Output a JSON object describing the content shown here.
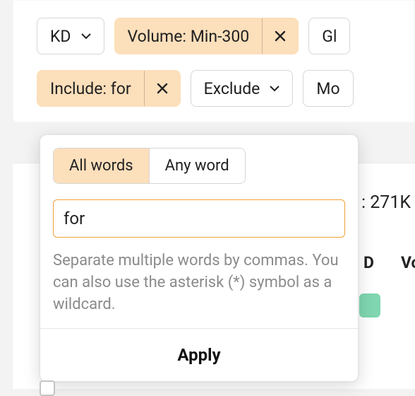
{
  "filters": {
    "kd_label": "KD",
    "volume_label": "Volume: Min-300",
    "global_label": "Gl",
    "include_label": "Include: for",
    "exclude_label": "Exclude",
    "more_label": "Mo"
  },
  "include_popover": {
    "all_words": "All words",
    "any_word": "Any word",
    "input_value": "for",
    "hint": "Separate multiple words by commas. You can also use the asterisk (*) symbol as a wildcard.",
    "apply_label": "Apply"
  },
  "results": {
    "total_label": ": 271K",
    "col_kd": "D",
    "col_vol": "Vo"
  }
}
